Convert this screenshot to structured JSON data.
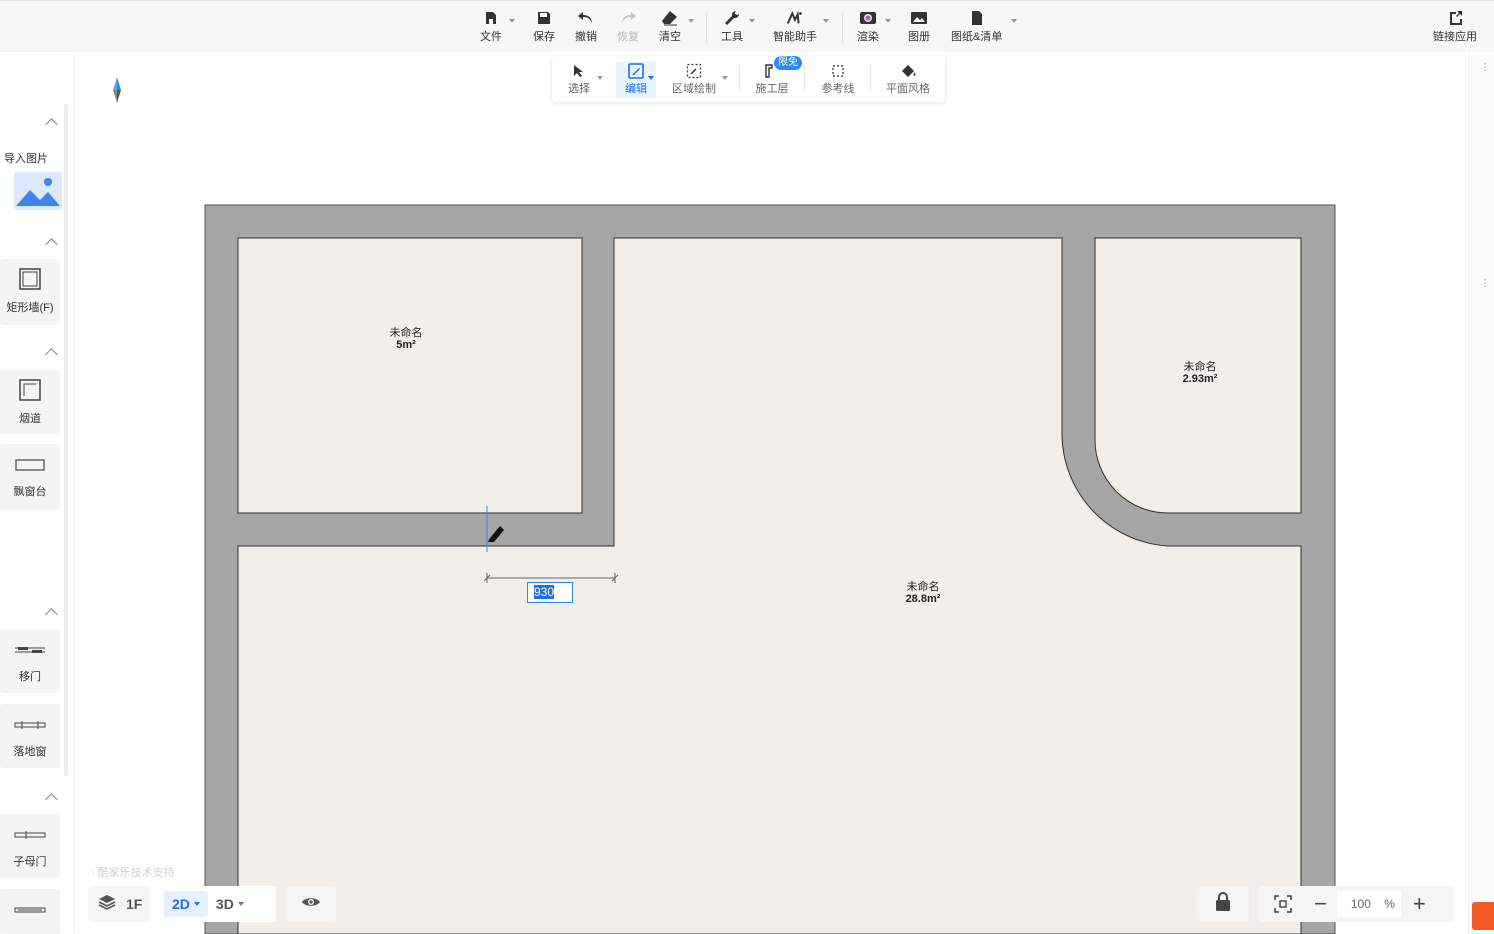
{
  "toolbar": {
    "file": "文件",
    "save": "保存",
    "undo": "撤销",
    "redo": "恢复",
    "clear": "清空",
    "tools": "工具",
    "assistant": "智能助手",
    "render": "渲染",
    "album": "图册",
    "drawings": "图纸&清单",
    "link_app": "链接应用"
  },
  "subtoolbar": {
    "select": "选择",
    "edit": "编辑",
    "area_draw": "区域绘制",
    "construction_layer": "施工层",
    "construction_badge": "限免",
    "reference_line": "参考线",
    "plan_style": "平面风格"
  },
  "left_panel": {
    "import_image": "导入图片",
    "rect_wall": "矩形墙(F)",
    "flue": "烟道",
    "bay_window": "飘窗台",
    "sliding_door": "移门",
    "floor_window": "落地窗",
    "mother_son_door": "子母门"
  },
  "rooms": [
    {
      "name": "未命名",
      "area": "5m²"
    },
    {
      "name": "未命名",
      "area": "2.93m²"
    },
    {
      "name": "未命名",
      "area": "28.8m²"
    }
  ],
  "dimension_value": "930",
  "watermark": "酷家乐技术支持",
  "bottom": {
    "floor": "1F",
    "view_2d": "2D",
    "view_3d": "3D",
    "zoom_value": "100",
    "zoom_unit": "%"
  },
  "colors": {
    "wall": "#a6a6a6",
    "floor": "#f2eeea",
    "accent": "#2e8cf0"
  }
}
